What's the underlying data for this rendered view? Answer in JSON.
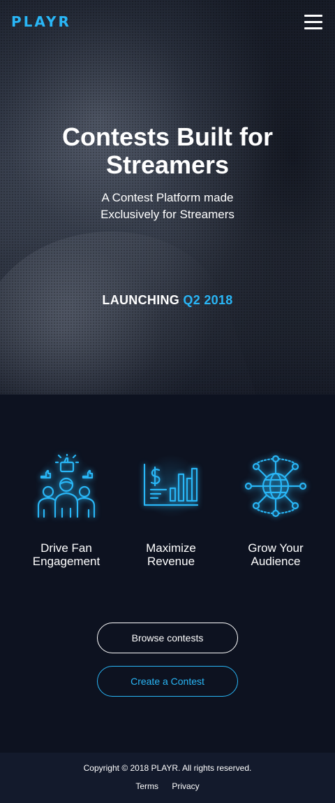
{
  "header": {
    "logo": "PLAYR",
    "menu_icon": "hamburger-menu-icon"
  },
  "hero": {
    "title": "Contests Built for Streamers",
    "subtitle_line1": "A Contest Platform made",
    "subtitle_line2": "Exclusively for Streamers",
    "launch_prefix": "LAUNCHING",
    "launch_highlight": "Q2 2018"
  },
  "features": [
    {
      "icon": "fan-engagement-icon",
      "line1": "Drive Fan",
      "line2": "Engagement"
    },
    {
      "icon": "revenue-chart-icon",
      "line1": "Maximize",
      "line2": "Revenue"
    },
    {
      "icon": "global-network-icon",
      "line1": "Grow Your",
      "line2": "Audience"
    }
  ],
  "buttons": {
    "browse": "Browse contests",
    "create": "Create a Contest"
  },
  "footer": {
    "copyright": "Copyright © 2018 PLAYR. All rights reserved.",
    "terms": "Terms",
    "privacy": "Privacy"
  },
  "colors": {
    "accent": "#29b6f6",
    "background": "#0d1220",
    "footer": "#131a2c"
  }
}
